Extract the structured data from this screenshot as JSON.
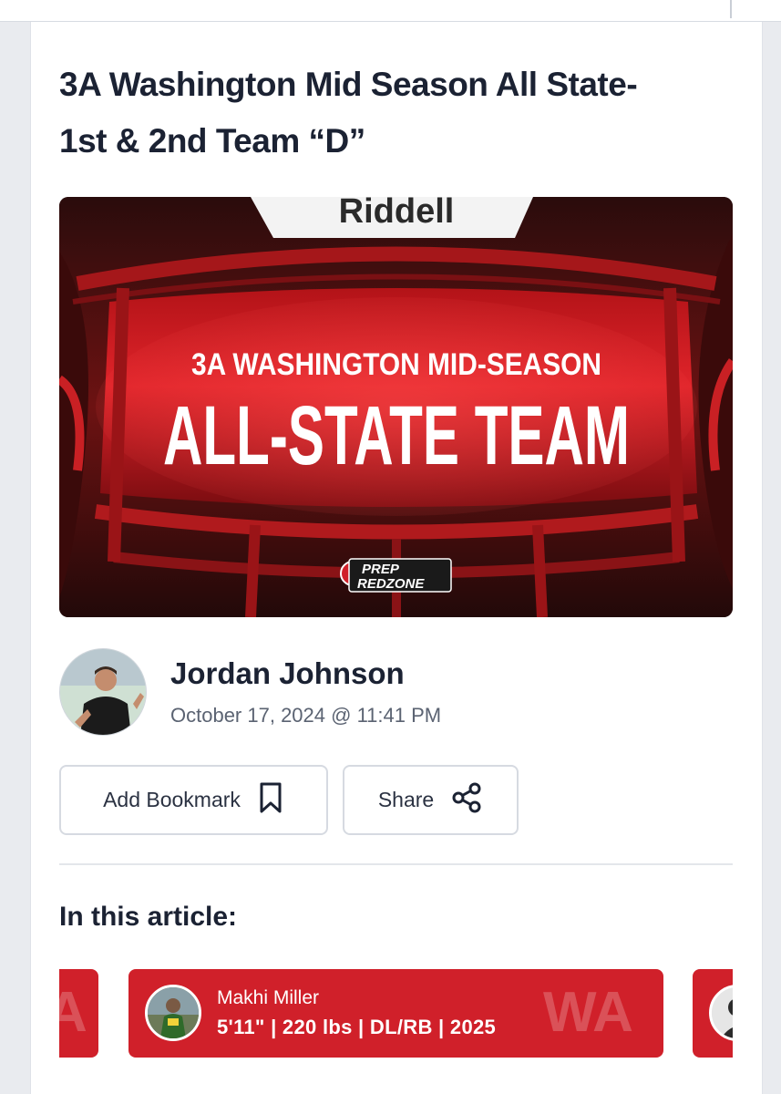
{
  "article": {
    "title_line1": "3A Washington Mid Season All State-",
    "title_line2": "1st & 2nd Team “D”"
  },
  "hero": {
    "helmet_brand": "Riddell",
    "subtitle": "3A WASHINGTON MID-SEASON",
    "headline": "ALL-STATE TEAM",
    "logo_line1": "PREP",
    "logo_line2": "REDZONE"
  },
  "author": {
    "name": "Jordan Johnson",
    "date": "October 17, 2024 @ 11:41 PM"
  },
  "actions": {
    "bookmark_label": "Add Bookmark",
    "bookmark_icon": "bookmark-icon",
    "share_label": "Share",
    "share_icon": "share-icon"
  },
  "in_article": {
    "heading": "In this article:",
    "players": [
      {
        "name": "Makhi Miller",
        "info": "5'11\" | 220 lbs | DL/RB | 2025",
        "state": "WA"
      }
    ],
    "left_card_state_partial": "A"
  },
  "colors": {
    "accent": "#d0202a",
    "text": "#1b2233",
    "muted": "#5b6372"
  }
}
